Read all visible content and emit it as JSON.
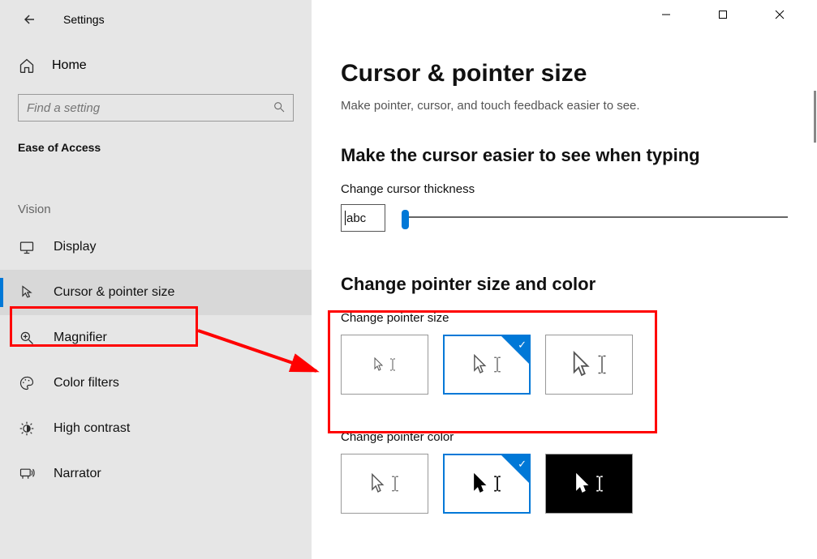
{
  "window": {
    "title": "Settings"
  },
  "sidebar": {
    "home": "Home",
    "search_placeholder": "Find a setting",
    "section": "Ease of Access",
    "group": "Vision",
    "items": [
      {
        "label": "Display",
        "icon": "display-icon"
      },
      {
        "label": "Cursor & pointer size",
        "icon": "cursor-icon",
        "selected": true
      },
      {
        "label": "Magnifier",
        "icon": "magnifier-icon"
      },
      {
        "label": "Color filters",
        "icon": "palette-icon"
      },
      {
        "label": "High contrast",
        "icon": "contrast-icon"
      },
      {
        "label": "Narrator",
        "icon": "narrator-icon"
      }
    ]
  },
  "page": {
    "title": "Cursor & pointer size",
    "subtitle": "Make pointer, cursor, and touch feedback easier to see.",
    "section_typing": "Make the cursor easier to see when typing",
    "thickness_label": "Change cursor thickness",
    "abc_sample": "abc",
    "section_sizecolor": "Change pointer size and color",
    "size_label": "Change pointer size",
    "color_label": "Change pointer color",
    "size_options": [
      {
        "name": "pointer-size-small",
        "selected": false
      },
      {
        "name": "pointer-size-medium",
        "selected": true
      },
      {
        "name": "pointer-size-large",
        "selected": false
      }
    ],
    "color_options": [
      {
        "name": "pointer-color-white",
        "selected": false,
        "bg": "white"
      },
      {
        "name": "pointer-color-black",
        "selected": true,
        "bg": "white"
      },
      {
        "name": "pointer-color-invert",
        "selected": false,
        "bg": "black"
      }
    ]
  }
}
